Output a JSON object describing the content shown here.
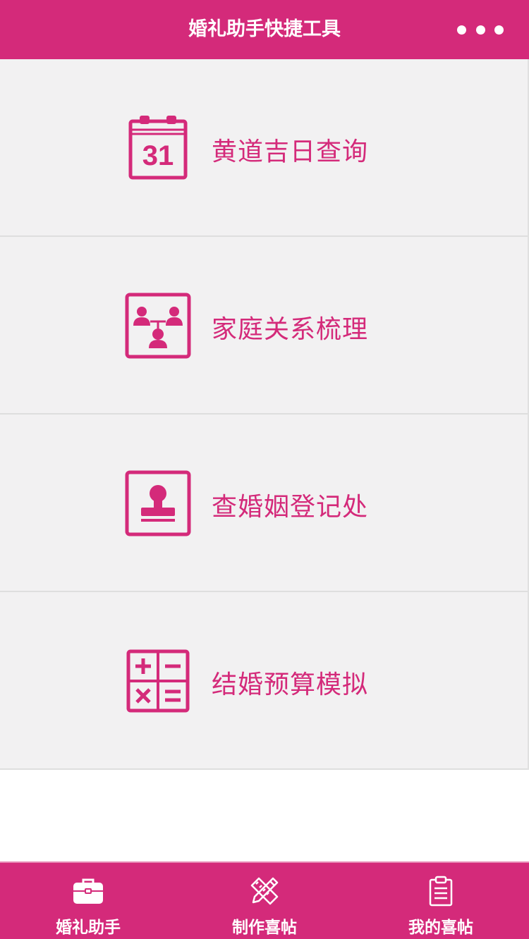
{
  "header": {
    "title": "婚礼助手快捷工具"
  },
  "menu": {
    "items": [
      {
        "label": "黄道吉日查询",
        "icon": "calendar-icon",
        "calendar_day": "31"
      },
      {
        "label": "家庭关系梳理",
        "icon": "family-tree-icon"
      },
      {
        "label": "查婚姻登记处",
        "icon": "stamp-icon"
      },
      {
        "label": "结婚预算模拟",
        "icon": "calculator-icon"
      }
    ]
  },
  "tabbar": {
    "items": [
      {
        "label": "婚礼助手",
        "icon": "briefcase-icon"
      },
      {
        "label": "制作喜帖",
        "icon": "pencil-ruler-icon"
      },
      {
        "label": "我的喜帖",
        "icon": "clipboard-icon"
      }
    ]
  },
  "colors": {
    "brand": "#d42a7a",
    "background": "#f2f1f2",
    "divider": "#dedede"
  }
}
